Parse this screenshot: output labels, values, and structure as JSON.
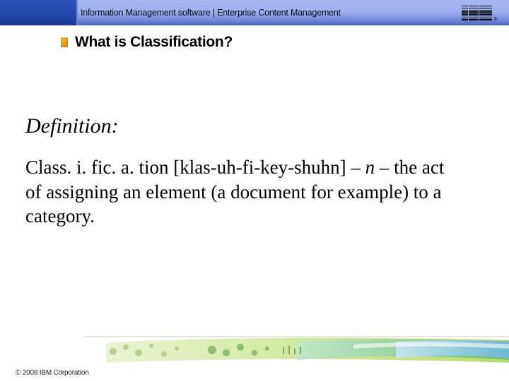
{
  "banner": {
    "text": "Information Management software | Enterprise Content Management",
    "logo_name": "ibm-logo-icon"
  },
  "title": "What is Classification?",
  "body": {
    "definition_label": "Definition:",
    "definition": {
      "word": "Class. i. fic. a. tion",
      "phon": "[klas-uh-fi-key-shuhn]",
      "sep1": " – ",
      "pos": "n",
      "sep2": " – ",
      "text": "the act of assigning an element (a document for example) to a category."
    }
  },
  "footer": {
    "copyright": "© 2008 IBM Corporation"
  }
}
